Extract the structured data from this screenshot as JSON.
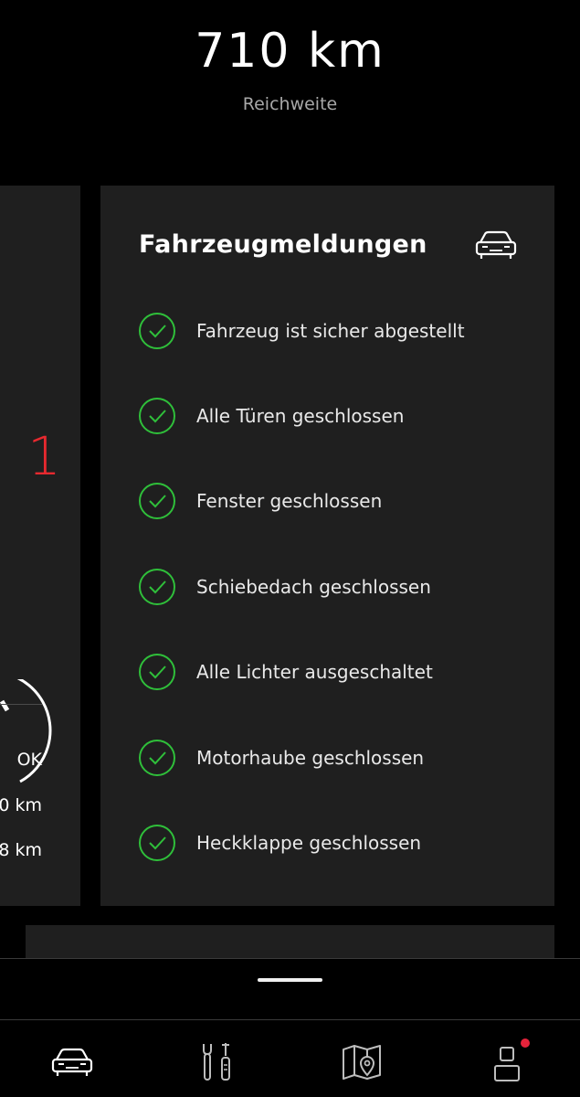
{
  "header": {
    "range_value": "710 km",
    "range_label": "Reichweite"
  },
  "left_card": {
    "partial_number": "1",
    "status_ok": "OK",
    "row_km_1": "0 km",
    "row_km_2": "8 km"
  },
  "vehicle_messages": {
    "title": "Fahrzeugmeldungen",
    "title_icon": "car-icon",
    "status_color": "#2fbf3a",
    "items": [
      {
        "label": "Fahrzeug ist sicher abgestellt",
        "status": "ok"
      },
      {
        "label": "Alle Türen geschlossen",
        "status": "ok"
      },
      {
        "label": "Fenster geschlossen",
        "status": "ok"
      },
      {
        "label": "Schiebedach geschlossen",
        "status": "ok"
      },
      {
        "label": "Alle Lichter ausgeschaltet",
        "status": "ok"
      },
      {
        "label": "Motorhaube geschlossen",
        "status": "ok"
      },
      {
        "label": "Heckklappe geschlossen",
        "status": "ok"
      }
    ]
  },
  "bottom_nav": {
    "items": [
      {
        "icon": "car-icon",
        "active": true
      },
      {
        "icon": "tools-icon",
        "active": false
      },
      {
        "icon": "map-icon",
        "active": false
      },
      {
        "icon": "profile-icon",
        "active": false,
        "notification": true
      }
    ],
    "notification_color": "#e6233b"
  }
}
